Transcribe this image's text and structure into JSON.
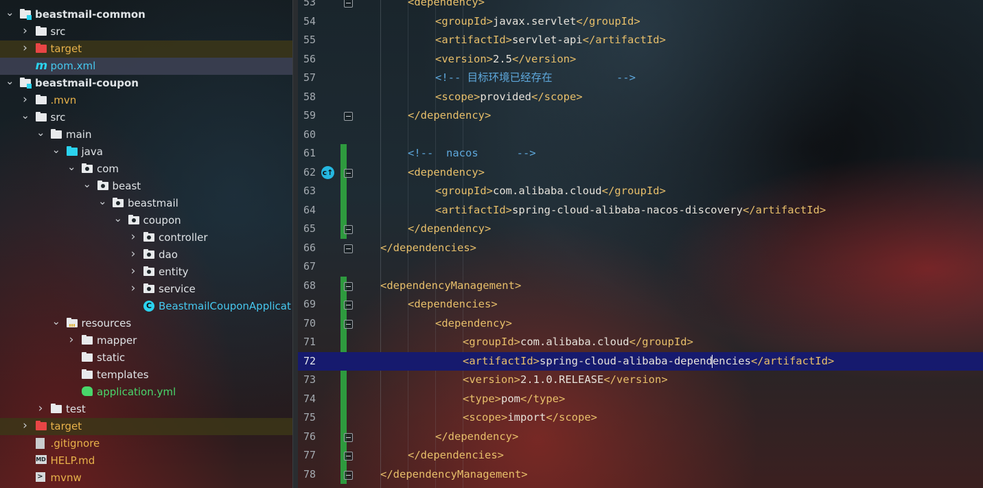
{
  "project_tree": {
    "rows": [
      {
        "label": "beastmail-common",
        "kind": "module",
        "depth": 0,
        "expanded": true
      },
      {
        "label": "src",
        "kind": "folder",
        "depth": 1,
        "expanded": false
      },
      {
        "label": "target",
        "kind": "folder-excluded",
        "depth": 1,
        "expanded": false
      },
      {
        "label": "pom.xml",
        "kind": "maven-file",
        "depth": 1
      },
      {
        "label": "beastmail-coupon",
        "kind": "module",
        "depth": 0,
        "expanded": true
      },
      {
        "label": ".mvn",
        "kind": "folder",
        "depth": 1,
        "expanded": false
      },
      {
        "label": "src",
        "kind": "folder",
        "depth": 1,
        "expanded": true
      },
      {
        "label": "main",
        "kind": "folder",
        "depth": 2,
        "expanded": true
      },
      {
        "label": "java",
        "kind": "source-root",
        "depth": 3,
        "expanded": true
      },
      {
        "label": "com",
        "kind": "package",
        "depth": 4,
        "expanded": true
      },
      {
        "label": "beast",
        "kind": "package",
        "depth": 5,
        "expanded": true
      },
      {
        "label": "beastmail",
        "kind": "package",
        "depth": 6,
        "expanded": true
      },
      {
        "label": "coupon",
        "kind": "package",
        "depth": 7,
        "expanded": true
      },
      {
        "label": "controller",
        "kind": "package",
        "depth": 8,
        "expanded": false
      },
      {
        "label": "dao",
        "kind": "package",
        "depth": 8,
        "expanded": false
      },
      {
        "label": "entity",
        "kind": "package",
        "depth": 8,
        "expanded": false
      },
      {
        "label": "service",
        "kind": "package",
        "depth": 8,
        "expanded": false
      },
      {
        "label": "BeastmailCouponApplicat",
        "kind": "spring-class",
        "depth": 8
      },
      {
        "label": "resources",
        "kind": "resources-root",
        "depth": 3,
        "expanded": true
      },
      {
        "label": "mapper",
        "kind": "folder",
        "depth": 4,
        "expanded": false
      },
      {
        "label": "static",
        "kind": "folder",
        "depth": 4
      },
      {
        "label": "templates",
        "kind": "folder",
        "depth": 4
      },
      {
        "label": "application.yml",
        "kind": "yml-file",
        "depth": 4
      },
      {
        "label": "test",
        "kind": "folder",
        "depth": 2,
        "expanded": false
      },
      {
        "label": "target",
        "kind": "folder-excluded",
        "depth": 1,
        "expanded": false
      },
      {
        "label": ".gitignore",
        "kind": "git-file",
        "depth": 1
      },
      {
        "label": "HELP.md",
        "kind": "md-file",
        "depth": 1
      },
      {
        "label": "mvnw",
        "kind": "shell-file",
        "depth": 1
      }
    ]
  },
  "editor": {
    "current_line": 72,
    "lines": [
      {
        "n": "53",
        "indent": 1,
        "html_parts": [
          [
            "tag",
            "<dependency>"
          ]
        ]
      },
      {
        "n": "54",
        "indent": 2,
        "html_parts": [
          [
            "tag",
            "<groupId>"
          ],
          [
            "txt",
            "javax.servlet"
          ],
          [
            "tag",
            "</groupId>"
          ]
        ]
      },
      {
        "n": "55",
        "indent": 2,
        "html_parts": [
          [
            "tag",
            "<artifactId>"
          ],
          [
            "txt",
            "servlet-api"
          ],
          [
            "tag",
            "</artifactId>"
          ]
        ]
      },
      {
        "n": "56",
        "indent": 2,
        "html_parts": [
          [
            "tag",
            "<version>"
          ],
          [
            "txt",
            "2.5"
          ],
          [
            "tag",
            "</version>"
          ]
        ]
      },
      {
        "n": "57",
        "indent": 2,
        "html_parts": [
          [
            "cmt",
            "<!-- 目标环境已经存在          -->"
          ]
        ]
      },
      {
        "n": "58",
        "indent": 2,
        "html_parts": [
          [
            "tag",
            "<scope>"
          ],
          [
            "txt",
            "provided"
          ],
          [
            "tag",
            "</scope>"
          ]
        ]
      },
      {
        "n": "59",
        "indent": 1,
        "html_parts": [
          [
            "tag",
            "</dependency>"
          ]
        ]
      },
      {
        "n": "60",
        "indent": 0,
        "html_parts": []
      },
      {
        "n": "61",
        "indent": 1,
        "html_parts": [
          [
            "cmt",
            "<!--  nacos      -->"
          ]
        ]
      },
      {
        "n": "62",
        "indent": 1,
        "html_parts": [
          [
            "tag",
            "<dependency>"
          ]
        ]
      },
      {
        "n": "63",
        "indent": 2,
        "html_parts": [
          [
            "tag",
            "<groupId>"
          ],
          [
            "txt",
            "com.alibaba.cloud"
          ],
          [
            "tag",
            "</groupId>"
          ]
        ]
      },
      {
        "n": "64",
        "indent": 2,
        "html_parts": [
          [
            "tag",
            "<artifactId>"
          ],
          [
            "txt",
            "spring-cloud-alibaba-nacos-discovery"
          ],
          [
            "tag",
            "</artifactId>"
          ]
        ]
      },
      {
        "n": "65",
        "indent": 1,
        "html_parts": [
          [
            "tag",
            "</dependency>"
          ]
        ]
      },
      {
        "n": "66",
        "indent": 0,
        "html_parts": [
          [
            "tag",
            "</dependencies>"
          ]
        ]
      },
      {
        "n": "67",
        "indent": 0,
        "html_parts": []
      },
      {
        "n": "68",
        "indent": 0,
        "html_parts": [
          [
            "tag",
            "<dependencyManagement>"
          ]
        ]
      },
      {
        "n": "69",
        "indent": 1,
        "html_parts": [
          [
            "tag",
            "<dependencies>"
          ]
        ]
      },
      {
        "n": "70",
        "indent": 2,
        "html_parts": [
          [
            "tag",
            "<dependency>"
          ]
        ]
      },
      {
        "n": "71",
        "indent": 3,
        "html_parts": [
          [
            "tag",
            "<groupId>"
          ],
          [
            "txt",
            "com.alibaba.cloud"
          ],
          [
            "tag",
            "</groupId>"
          ]
        ]
      },
      {
        "n": "72",
        "indent": 3,
        "html_parts": [
          [
            "tag",
            "<artifactId>"
          ],
          [
            "txt",
            "spring-cloud-alibaba-depend"
          ],
          [
            "caret",
            ""
          ],
          [
            "txt",
            "encies"
          ],
          [
            "tag",
            "</artifactId>"
          ]
        ]
      },
      {
        "n": "73",
        "indent": 3,
        "html_parts": [
          [
            "tag",
            "<version>"
          ],
          [
            "txt",
            "2.1.0.RELEASE"
          ],
          [
            "tag",
            "</version>"
          ]
        ]
      },
      {
        "n": "74",
        "indent": 3,
        "html_parts": [
          [
            "tag",
            "<type>"
          ],
          [
            "txt",
            "pom"
          ],
          [
            "tag",
            "</type>"
          ]
        ]
      },
      {
        "n": "75",
        "indent": 3,
        "html_parts": [
          [
            "tag",
            "<scope>"
          ],
          [
            "txt",
            "import"
          ],
          [
            "tag",
            "</scope>"
          ]
        ]
      },
      {
        "n": "76",
        "indent": 2,
        "html_parts": [
          [
            "tag",
            "</dependency>"
          ]
        ]
      },
      {
        "n": "77",
        "indent": 1,
        "html_parts": [
          [
            "tag",
            "</dependencies>"
          ]
        ]
      },
      {
        "n": "78",
        "indent": 0,
        "html_parts": [
          [
            "tag",
            "</dependencyManagement>"
          ]
        ]
      }
    ],
    "fold_lines": [
      "53",
      "59",
      "62",
      "65",
      "66",
      "68",
      "69",
      "70",
      "76",
      "77",
      "78"
    ],
    "changed_ranges": [
      [
        "61",
        "65"
      ],
      [
        "68",
        "78"
      ]
    ],
    "gutter_icon": {
      "line": "62",
      "name": "spring-navigate-icon",
      "glyph": "c↑"
    },
    "colors": {
      "tag": "#e8bf6a",
      "comment": "#5ea8dc",
      "current_line_bg": "#161a6e",
      "change_bar": "#2e9a3e"
    }
  }
}
